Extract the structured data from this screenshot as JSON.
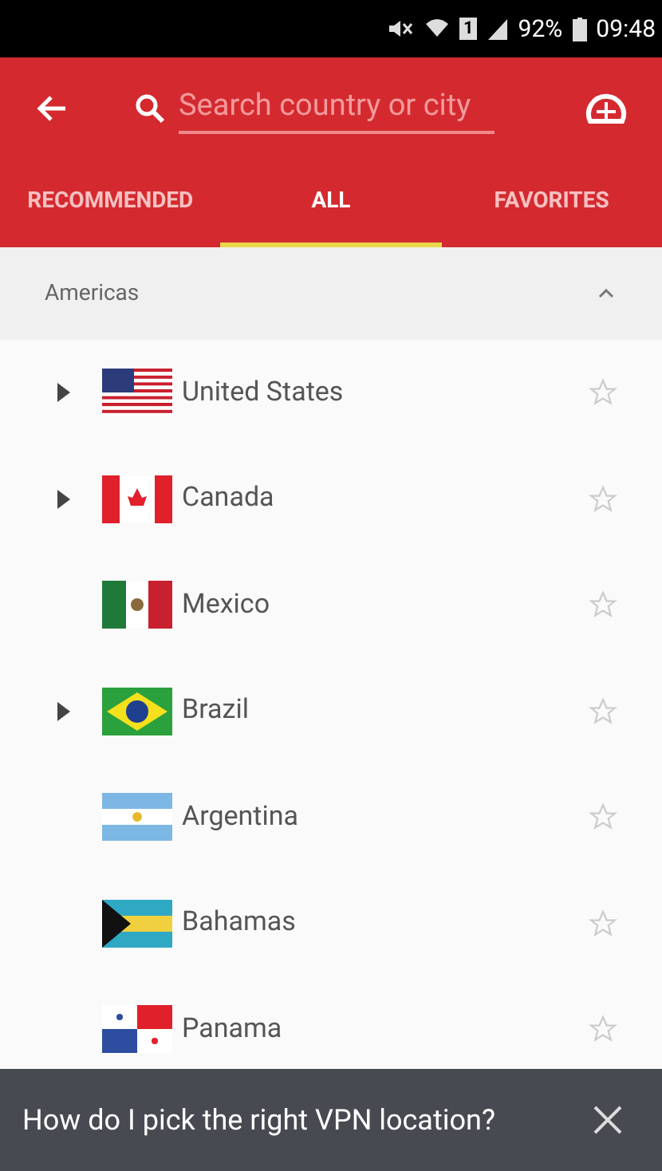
{
  "status_bar": {
    "sim": "1",
    "battery": "92%",
    "time": "09:48"
  },
  "toolbar": {
    "search": {
      "placeholder": "Search country or city"
    }
  },
  "tabs": [
    {
      "label": "RECOMMENDED",
      "selected": false
    },
    {
      "label": "ALL",
      "selected": true
    },
    {
      "label": "FAVORITES",
      "selected": false
    }
  ],
  "section": {
    "title": "Americas",
    "expanded": true
  },
  "countries": [
    {
      "name": "United States",
      "expandable": true,
      "favorite": false
    },
    {
      "name": "Canada",
      "expandable": true,
      "favorite": false
    },
    {
      "name": "Mexico",
      "expandable": false,
      "favorite": false
    },
    {
      "name": "Brazil",
      "expandable": true,
      "favorite": false
    },
    {
      "name": "Argentina",
      "expandable": false,
      "favorite": false
    },
    {
      "name": "Bahamas",
      "expandable": false,
      "favorite": false
    },
    {
      "name": "Panama",
      "expandable": false,
      "favorite": false
    }
  ],
  "snackbar": {
    "message": "How do I pick the right VPN location?"
  }
}
